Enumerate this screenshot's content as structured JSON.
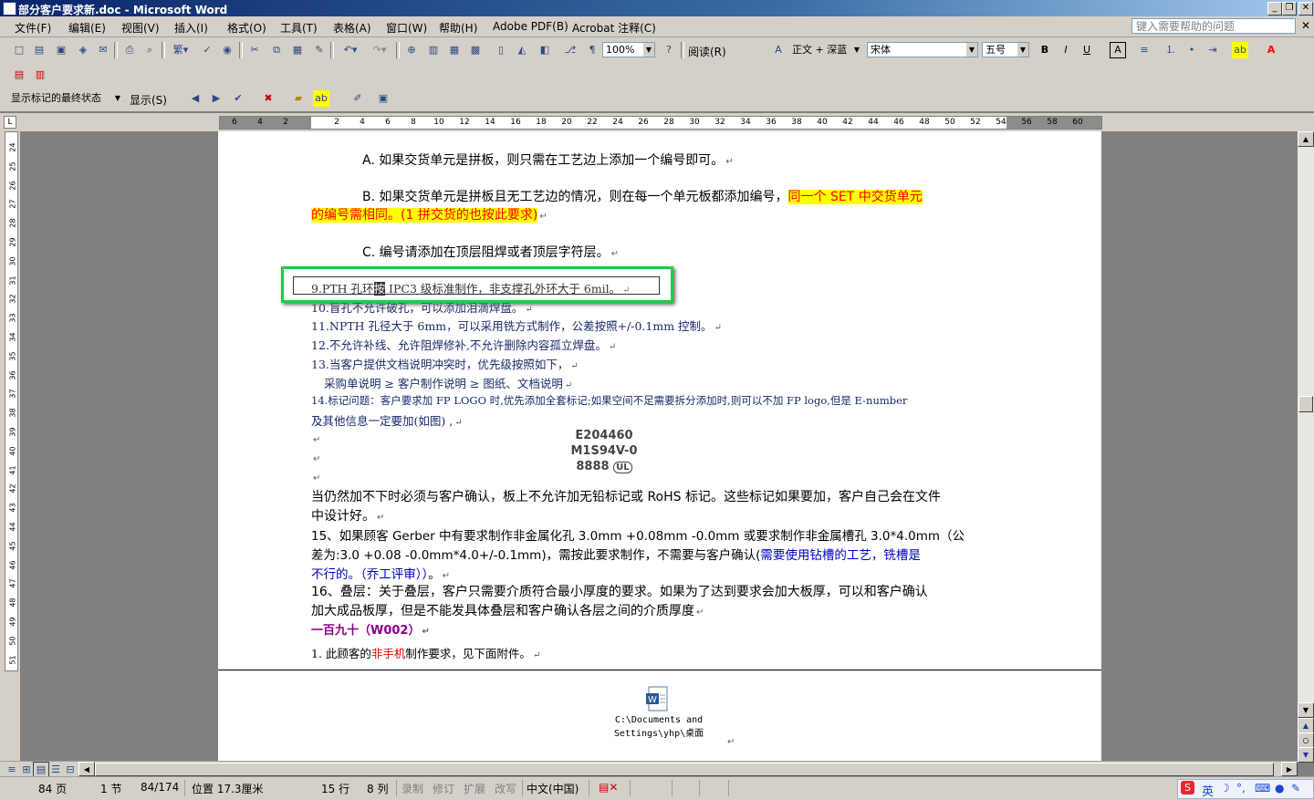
{
  "window": {
    "title": "部分客户要求新.doc - Microsoft Word",
    "buttons": [
      "_",
      "❐",
      "✕"
    ]
  },
  "menubar": {
    "items": [
      "文件(F)",
      "编辑(E)",
      "视图(V)",
      "插入(I)",
      "格式(O)",
      "工具(T)",
      "表格(A)",
      "窗口(W)",
      "帮助(H)",
      "Adobe PDF(B)",
      "Acrobat 注释(C)"
    ],
    "help_placeholder": "键入需要帮助的问题",
    "close": "✕"
  },
  "toolbar_standard": {
    "zoom": "100%",
    "read_label": "阅读(R)"
  },
  "toolbar_format": {
    "style": "正文 + 深蓝",
    "font": "宋体",
    "size": "五号",
    "bold": "B",
    "italic": "I",
    "underline": "U",
    "char_border": "A"
  },
  "toolbar_review": {
    "display_mode": "显示标记的最终状态",
    "show_label": "显示(S)"
  },
  "ruler": {
    "ticks": [
      "6",
      "4",
      "2",
      "",
      "2",
      "4",
      "6",
      "8",
      "10",
      "12",
      "14",
      "16",
      "18",
      "20",
      "22",
      "24",
      "26",
      "28",
      "30",
      "32",
      "34",
      "36",
      "38",
      "40",
      "42",
      "44",
      "46",
      "48",
      "50",
      "52",
      "54",
      "56",
      "58",
      "60"
    ],
    "vticks": [
      "24",
      "25",
      "26",
      "27",
      "28",
      "29",
      "30",
      "31",
      "32",
      "33",
      "34",
      "35",
      "36",
      "37",
      "38",
      "39",
      "40",
      "41",
      "42",
      "43",
      "44",
      "45",
      "46",
      "47",
      "48",
      "49",
      "50",
      "51"
    ]
  },
  "document": {
    "para_a": "A. 如果交货单元是拼板，则只需在工艺边上添加一个编号即可。",
    "para_b_1": "B. 如果交货单元是拼板且无工艺边的情况，则在每一个单元板都添加编号，",
    "para_b_hl1": "同一个 SET 中交货单元",
    "para_b_hl2": "的编号需相同。(1 拼交货的也按此要求)",
    "para_c": "C. 编号请添加在顶层阻焊或者顶层字符层。",
    "item9_pre": "9.PTH 孔环",
    "item9_sel": "按",
    "item9_post": " IPC3 级标准制作，非支撑孔外环大于 6mil。",
    "item10": "10.盲孔不允许破孔，可以添加泪滴焊盘。",
    "item11": "11.NPTH 孔径大于 6mm，可以采用铣方式制作，公差按照+/-0.1mm 控制。",
    "item12": "12.不允许补线、允许阻焊修补,不允许删除内容孤立焊盘。",
    "item13": "13.当客户提供文档说明冲突时，优先级按照如下，",
    "item13_order": "采购单说明 ≥ 客户制作说明 ≥ 图纸、文档说明",
    "item14_1": "14.标记问题：客户要求加 FP LOGO 时,优先添加全套标记;如果空间不足需要拆分添加时,则可以不加 FP logo,但是 E-number",
    "item14_2": "及其他信息一定要加(如图)        ,",
    "logo_line1": "E204460",
    "logo_line2": "M1S94V-0",
    "logo_line3": "8888",
    "para_rohs_1": "当仍然加不下时必须与客户确认，板上不允许加无铅标记或 RoHS 标记。这些标记如果要加，客户自己会在文件",
    "para_rohs_2": "中设计好。",
    "item15_1": "15、如果顾客 Gerber 中有要求制作非金属化孔 3.0mm +0.08mm -0.0mm 或要求制作非金属槽孔 3.0*4.0mm（公",
    "item15_2": "差为:3.0 +0.08 -0.0mm*4.0+/-0.1mm)，需按此要求制作，不需要与客户确认(",
    "item15_2_blue": "需要使用钻槽的工艺，铣槽是",
    "item15_3_blue": "不行的。（乔工评审））",
    "item15_3_end": "。",
    "item16_1": "16、叠层：关于叠层，客户只需要介质符合最小厚度的要求。如果为了达到要求会加大板厚，可以和客户确认",
    "item16_2": "加大成品板厚，但是不能发具体叠层和客户确认各层之间的介质厚度",
    "heading_190": "一百九十（W002）",
    "item1_pre": "1. 此顾客的",
    "item1_red": "非手机",
    "item1_post": "制作要求，见下面附件。",
    "embed_path_1": "C:\\Documents and",
    "embed_path_2": "Settings\\yhp\\桌面",
    "para_mark": "↵"
  },
  "statusbar": {
    "page": "84 页",
    "section": "1 节",
    "page_of": "84/174",
    "position": "位置 17.3厘米",
    "line": "15 行",
    "column": "8 列",
    "rec": "录制",
    "trk": "修订",
    "ext": "扩展",
    "ovr": "改写",
    "lang": "中文(中国)",
    "ime_lang": "英"
  }
}
